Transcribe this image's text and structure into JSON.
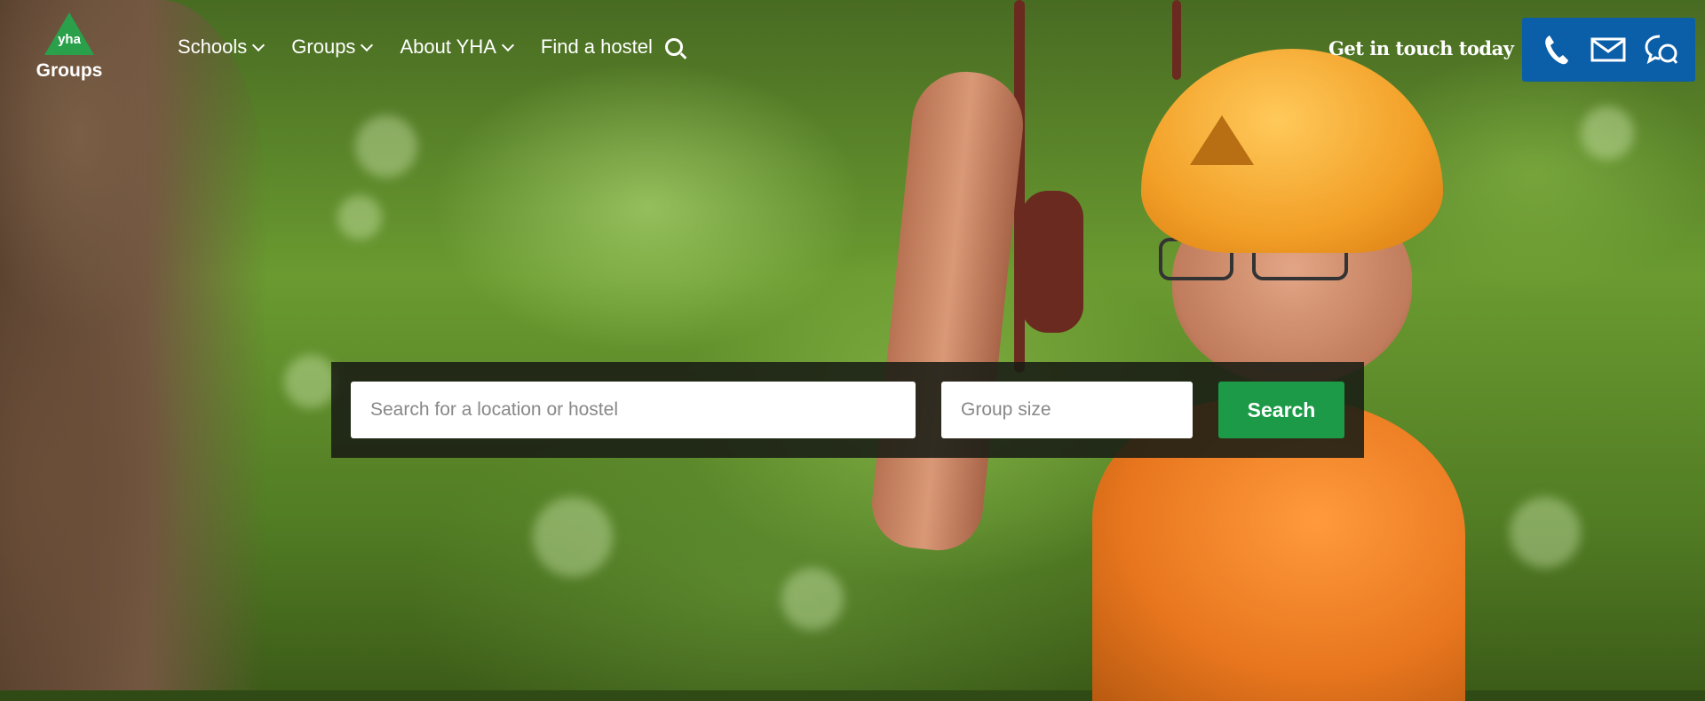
{
  "brand": {
    "logo_mark": "yha",
    "logo_text": "Groups"
  },
  "nav": {
    "items": [
      {
        "label": "Schools",
        "has_dropdown": true
      },
      {
        "label": "Groups",
        "has_dropdown": true
      },
      {
        "label": "About YHA",
        "has_dropdown": true
      },
      {
        "label": "Find a hostel",
        "has_search_icon": true
      }
    ]
  },
  "contact": {
    "cta_label": "Get in touch today",
    "icons": [
      "phone-icon",
      "email-icon",
      "chat-icon"
    ],
    "box_color": "#0b5ea8"
  },
  "search": {
    "location_placeholder": "Search for a location or hostel",
    "group_placeholder": "Group size",
    "button_label": "Search",
    "button_color": "#1d9a48"
  },
  "hero": {
    "image_subject": "hero-photo"
  }
}
